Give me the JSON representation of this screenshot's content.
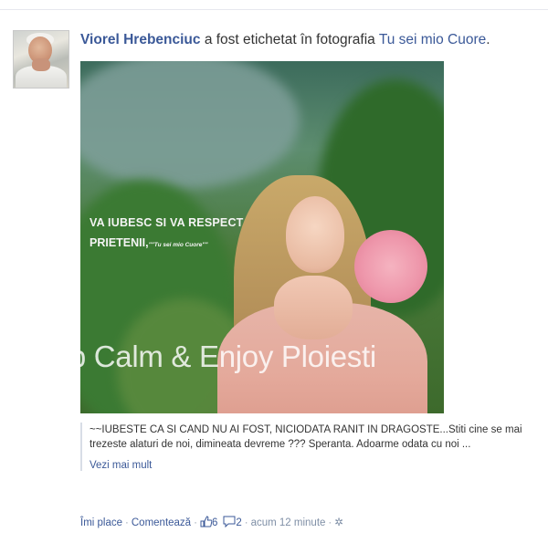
{
  "story": {
    "actor_name": "Viorel Hrebenciuc",
    "action_text": " a fost etichetat în fotografia ",
    "photo_title": "Tu sei mio Cuore",
    "photo_title_suffix": "."
  },
  "photo": {
    "overlay_line1": "VA IUBESC SI VA RESPECT",
    "overlay_line2": "PRIETENII,",
    "overlay_signature": "\"\"Tu sei mio Cuore\"\""
  },
  "watermark": "Keep Calm & Enjoy Ploiesti",
  "caption": {
    "text": "~~IUBESTE CA SI CAND NU AI FOST, NICIODATA RANIT IN DRAGOSTE...Stiti cine se mai trezeste alaturi de noi, dimineata devreme ??? Speranta. Adoarme odata cu noi ...",
    "see_more": "Vezi mai mult"
  },
  "actions": {
    "like": "Îmi place",
    "comment": "Comentează",
    "like_count": "6",
    "comment_count": "2",
    "timestamp": "acum 12 minute",
    "settings_glyph": "✲"
  },
  "icons": [
    "thumbs-up-icon",
    "comment-icon",
    "gear-icon"
  ],
  "colors": {
    "link": "#3b5998",
    "meta": "#7f8fa6"
  }
}
